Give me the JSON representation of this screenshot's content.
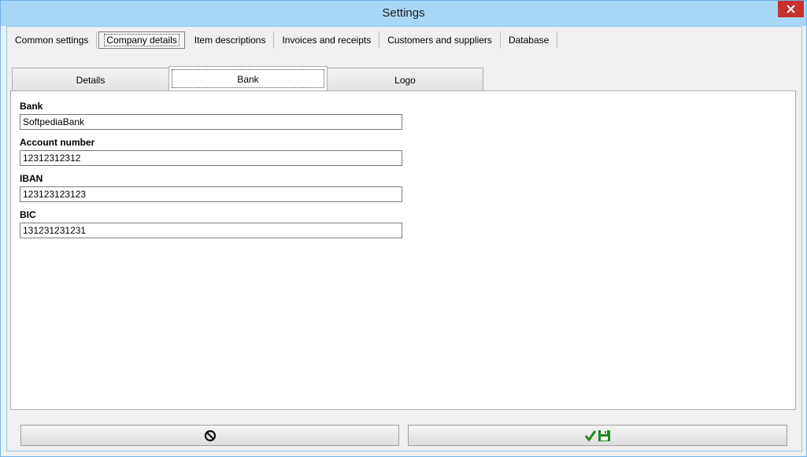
{
  "window": {
    "title": "Settings"
  },
  "outer_tabs": [
    {
      "label": "Common settings"
    },
    {
      "label": "Company details",
      "active": true
    },
    {
      "label": "Item descriptions"
    },
    {
      "label": "Invoices and receipts"
    },
    {
      "label": "Customers and suppliers"
    },
    {
      "label": "Database"
    }
  ],
  "inner_tabs": {
    "details": "Details",
    "bank": "Bank",
    "logo": "Logo",
    "active": "Bank"
  },
  "fields": {
    "bank": {
      "label": "Bank",
      "value": "SoftpediaBank"
    },
    "account_number": {
      "label": "Account number",
      "value": "12312312312"
    },
    "iban": {
      "label": "IBAN",
      "value": "123123123123"
    },
    "bic": {
      "label": "BIC",
      "value": "131231231231"
    }
  },
  "buttons": {
    "cancel_icon": "cancel-icon",
    "save_icons": [
      "check-icon",
      "floppy-disk-icon"
    ]
  },
  "colors": {
    "titlebar": "#a9d7f7",
    "close": "#c7302c",
    "accent_green": "#1e8a1e"
  }
}
